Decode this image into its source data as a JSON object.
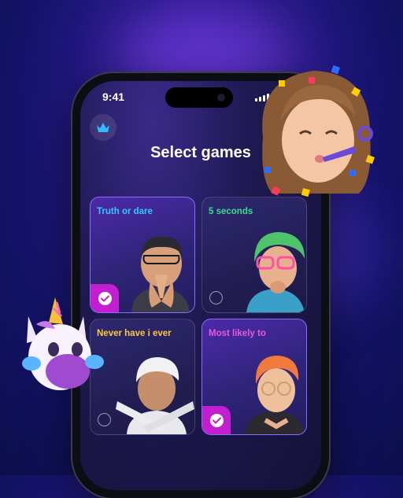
{
  "status_bar": {
    "time": "9:41"
  },
  "page": {
    "title": "Select games"
  },
  "games": [
    {
      "label": "Truth or dare",
      "selected": true,
      "label_color": "#35c8ff"
    },
    {
      "label": "5 seconds",
      "selected": false,
      "label_color": "#3cdc8c"
    },
    {
      "label": "Never have i ever",
      "selected": false,
      "label_color": "#ffc83c"
    },
    {
      "label": "Most likely to",
      "selected": true,
      "label_color": "#e65adc"
    }
  ],
  "icons": {
    "premium": "crown-icon",
    "selected": "checkmark-icon",
    "unselected": "radio-circle-icon"
  },
  "colors": {
    "accent": "#c21fd1",
    "selected_border": "#8a6cff",
    "crown": "#35b8ff"
  }
}
